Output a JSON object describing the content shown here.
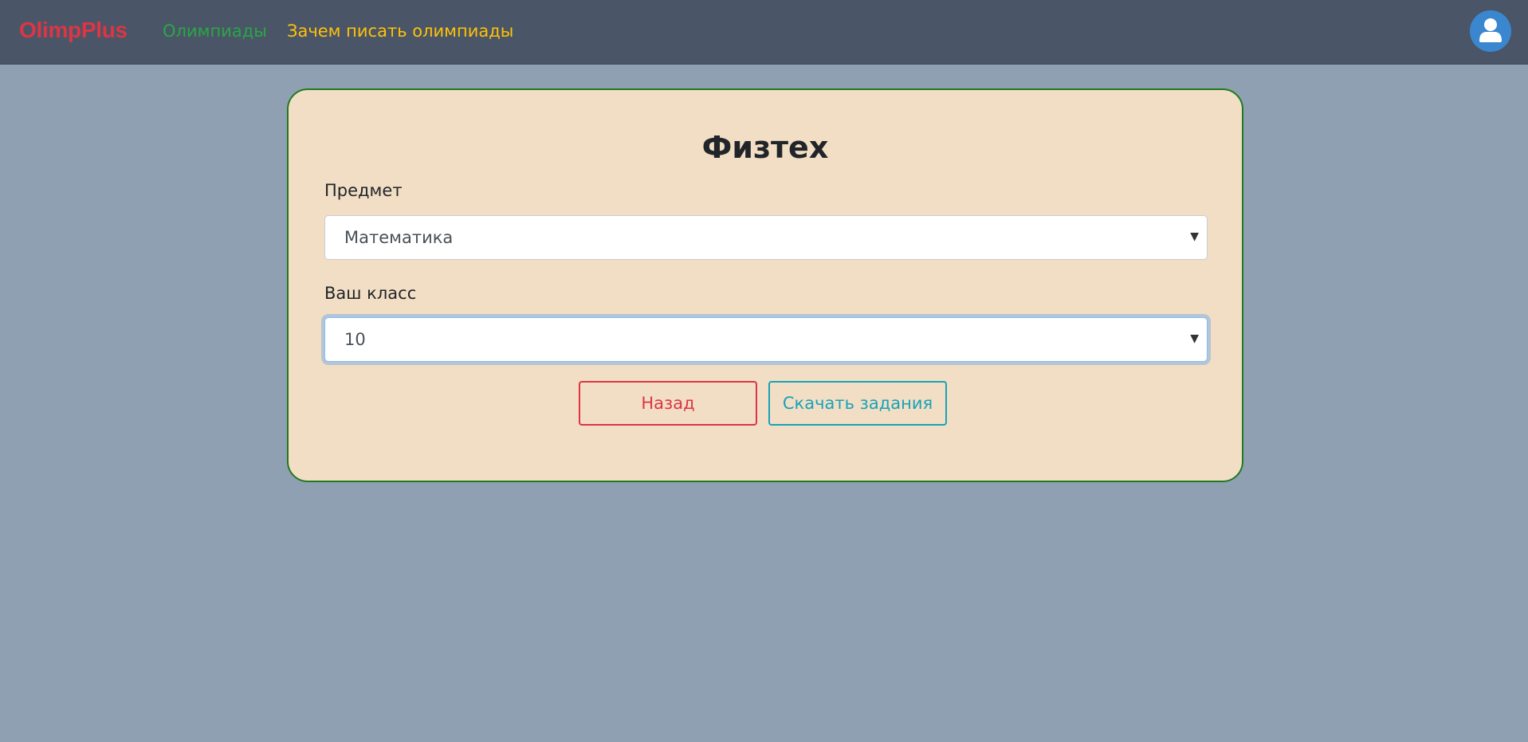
{
  "navbar": {
    "brand": "OlimpPlus",
    "links": [
      {
        "label": "Олимпиады"
      },
      {
        "label": "Зачем писать олимпиады"
      }
    ],
    "avatar_icon": "user-avatar-icon"
  },
  "card": {
    "title": "Физтех",
    "subject": {
      "label": "Предмет",
      "selected": "Математика"
    },
    "grade": {
      "label": "Ваш класс",
      "selected": "10"
    },
    "buttons": {
      "back": "Назад",
      "download": "Скачать задания"
    }
  },
  "colors": {
    "page_bg": "#8fa0b2",
    "navbar_bg": "#4a5667",
    "brand": "#dc3545",
    "link_green": "#28a745",
    "link_yellow": "#ffc107",
    "card_bg": "#f2dec5",
    "card_border": "#1f7a1f",
    "danger": "#dc3545",
    "info": "#17a2b8"
  }
}
